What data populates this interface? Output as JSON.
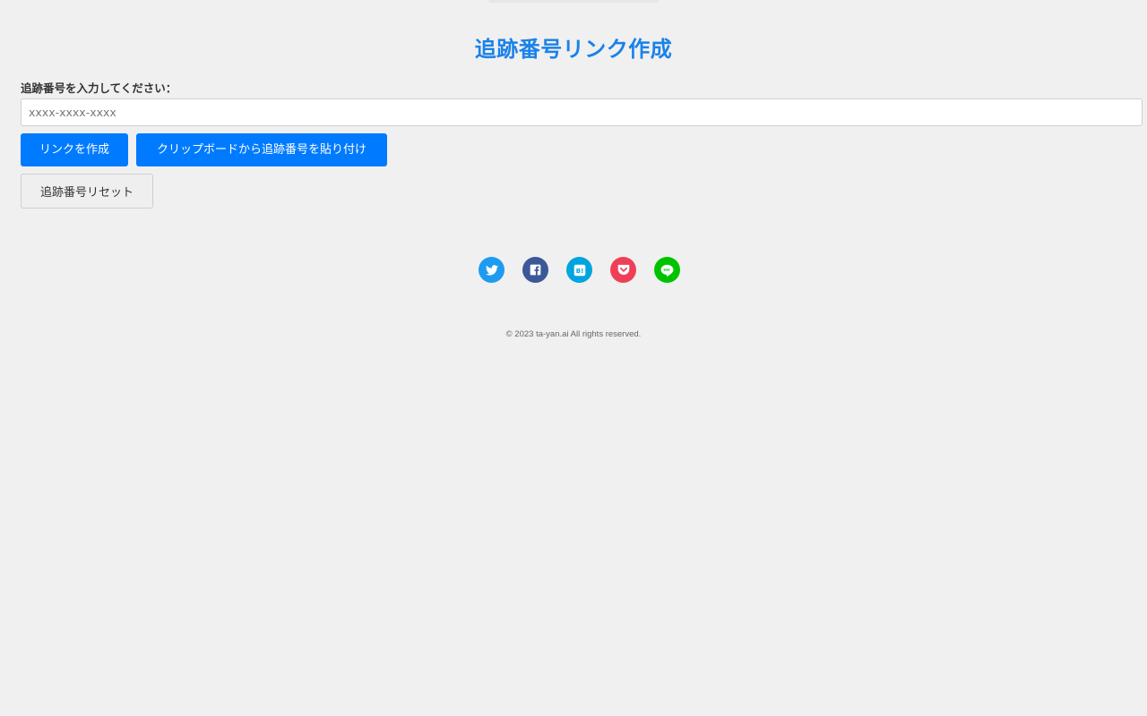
{
  "page": {
    "title": "追跡番号リンク作成"
  },
  "form": {
    "label": "追跡番号を入力してください：",
    "input_value": "",
    "input_placeholder": "xxxx-xxxx-xxxx"
  },
  "buttons": {
    "create_link": "リンクを作成",
    "paste_clipboard": "クリップボードから追跡番号を貼り付け",
    "reset": "追跡番号リセット"
  },
  "share": {
    "items": [
      {
        "service": "twitter",
        "icon": "twitter-icon",
        "color": "#1d9bf0"
      },
      {
        "service": "facebook",
        "icon": "facebook-icon",
        "color": "#3b5998"
      },
      {
        "service": "hatena",
        "icon": "hatena-bookmark-icon",
        "color": "#00a4de"
      },
      {
        "service": "pocket",
        "icon": "pocket-icon",
        "color": "#ef3f56"
      },
      {
        "service": "line",
        "icon": "line-icon",
        "color": "#00c300"
      }
    ]
  },
  "footer": {
    "copyright": "© 2023 ta-yan.ai All rights reserved."
  },
  "colors": {
    "accent": "#1a82e8",
    "primary_button": "#007bff",
    "background": "#f0f0f0"
  }
}
